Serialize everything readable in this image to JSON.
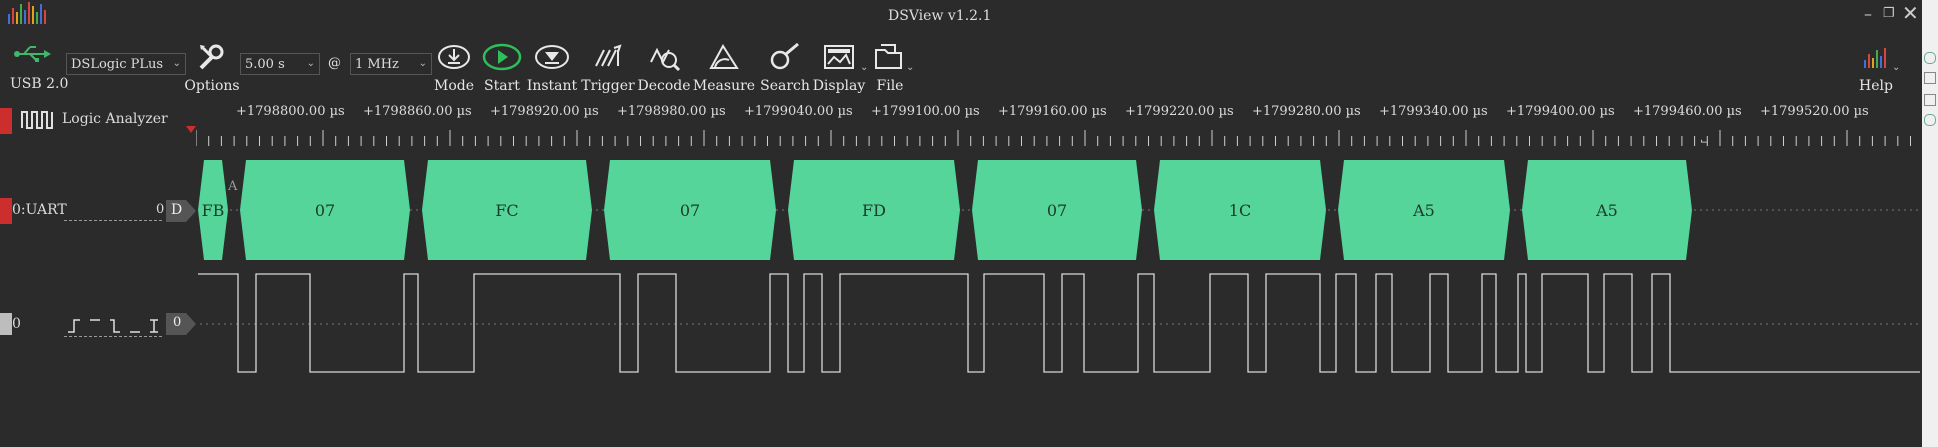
{
  "window": {
    "title": "DSView v1.2.1"
  },
  "toolbar": {
    "usb_label": "USB 2.0",
    "device": "DSLogic PLus",
    "options_label": "Options",
    "duration": "5.00 s",
    "at_label": "@",
    "rate": "1 MHz",
    "mode_label": "Mode",
    "start_label": "Start",
    "instant_label": "Instant",
    "trigger_label": "Trigger",
    "decode_label": "Decode",
    "measure_label": "Measure",
    "search_label": "Search",
    "display_label": "Display",
    "file_label": "File",
    "help_label": "Help"
  },
  "ruler": {
    "ticks": [
      "+1798800.00 µs",
      "+1798860.00 µs",
      "+1798920.00 µs",
      "+1798980.00 µs",
      "+1799040.00 µs",
      "+1799100.00 µs",
      "+1799160.00 µs",
      "+1799220.00 µs",
      "+1799280.00 µs",
      "+1799340.00 µs",
      "+1799400.00 µs",
      "+1799460.00 µs",
      "+1799520.00 µs"
    ]
  },
  "panel": {
    "logic_label": "Logic Analyzer"
  },
  "uart": {
    "name": "0:UART",
    "index": "0",
    "badge": "D",
    "partial_label": "A",
    "bytes": [
      "FB",
      "07",
      "FC",
      "07",
      "FD",
      "07",
      "1C",
      "A5",
      "A5"
    ],
    "color": "#55d59a"
  },
  "channel0": {
    "name": "0",
    "badge": "0"
  }
}
